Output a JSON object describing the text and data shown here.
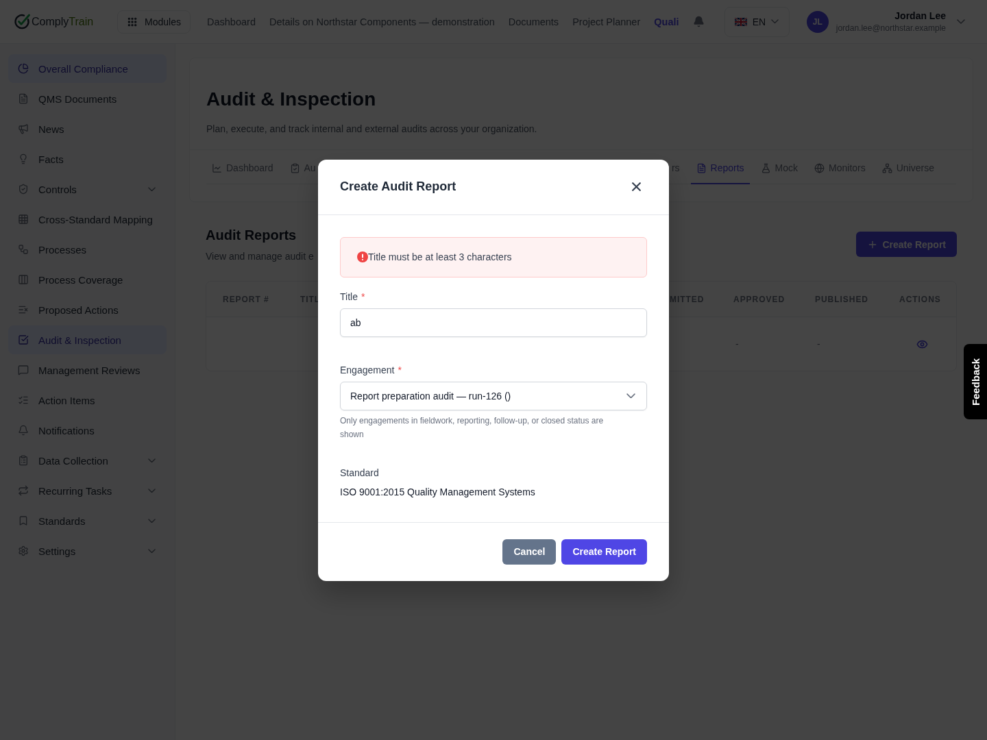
{
  "topbar": {
    "logo": {
      "first": "Comply",
      "second": "Train"
    },
    "modules_button": "Modules",
    "nav": [
      {
        "label": "Dashboard",
        "selected": false
      },
      {
        "label": "Details on Northstar Components — demonstration",
        "selected": false
      },
      {
        "label": "Documents",
        "selected": false
      },
      {
        "label": "Project Planner",
        "selected": false
      },
      {
        "label": "Quali",
        "selected": true
      }
    ],
    "language": "EN",
    "user": {
      "initials": "JL",
      "name": "Jordan Lee",
      "email": "jordan.lee@northstar.example"
    }
  },
  "sidebar": {
    "items": [
      {
        "label": "Overall Compliance",
        "selected": true,
        "expandable": false
      },
      {
        "label": "QMS Documents",
        "selected": false,
        "expandable": false
      },
      {
        "label": "News",
        "selected": false,
        "expandable": false
      },
      {
        "label": "Facts",
        "selected": false,
        "expandable": false
      },
      {
        "label": "Controls",
        "selected": false,
        "expandable": true
      },
      {
        "label": "Cross-Standard Mapping",
        "selected": false,
        "expandable": false
      },
      {
        "label": "Processes",
        "selected": false,
        "expandable": false
      },
      {
        "label": "Process Coverage",
        "selected": false,
        "expandable": false
      },
      {
        "label": "Proposed Actions",
        "selected": false,
        "expandable": false
      },
      {
        "label": "Audit & Inspection",
        "selected": true,
        "expandable": false
      },
      {
        "label": "Management Reviews",
        "selected": false,
        "expandable": false
      },
      {
        "label": "Action Items",
        "selected": false,
        "expandable": false
      },
      {
        "label": "Notifications",
        "selected": false,
        "expandable": false
      },
      {
        "label": "Data Collection",
        "selected": false,
        "expandable": true
      },
      {
        "label": "Recurring Tasks",
        "selected": false,
        "expandable": true
      },
      {
        "label": "Standards",
        "selected": false,
        "expandable": true
      },
      {
        "label": "Settings",
        "selected": false,
        "expandable": true
      }
    ]
  },
  "page": {
    "title": "Audit & Inspection",
    "subtitle": "Plan, execute, and track internal and external audits across your organization.",
    "tabs": [
      {
        "label": "Dashboard",
        "selected": false
      },
      {
        "label": "Au",
        "selected": false
      },
      {
        "label": "rs",
        "selected": false
      },
      {
        "label": "Reports",
        "selected": true
      },
      {
        "label": "Mock",
        "selected": false
      },
      {
        "label": "Monitors",
        "selected": false
      },
      {
        "label": "Universe",
        "selected": false
      }
    ]
  },
  "section": {
    "title": "Audit Reports",
    "subtitle": "View and manage audit e",
    "create_button": "Create Report"
  },
  "table": {
    "columns": [
      "REPORT #",
      "TITL",
      "MITTED",
      "APPROVED",
      "PUBLISHED",
      "ACTIONS"
    ],
    "rows": [
      {
        "approved": "-",
        "published": "-"
      }
    ]
  },
  "modal": {
    "title": "Create Audit Report",
    "error": "Title must be at least 3 characters",
    "fields": [
      {
        "kind": "text",
        "label": "Title",
        "required_mark": "*",
        "value": "ab"
      },
      {
        "kind": "select",
        "label": "Engagement",
        "required_mark": "*",
        "value": "Report preparation audit — run-126 ()",
        "help": "Only engagements in fieldwork, reporting, follow-up, or closed status are shown"
      },
      {
        "kind": "static",
        "label": "Standard",
        "value": "ISO 9001:2015 Quality Management Systems"
      }
    ],
    "buttons": [
      {
        "label": "Cancel",
        "kind": "secondary"
      },
      {
        "label": "Create Report",
        "kind": "primary"
      }
    ]
  },
  "feedback": "Feedback"
}
